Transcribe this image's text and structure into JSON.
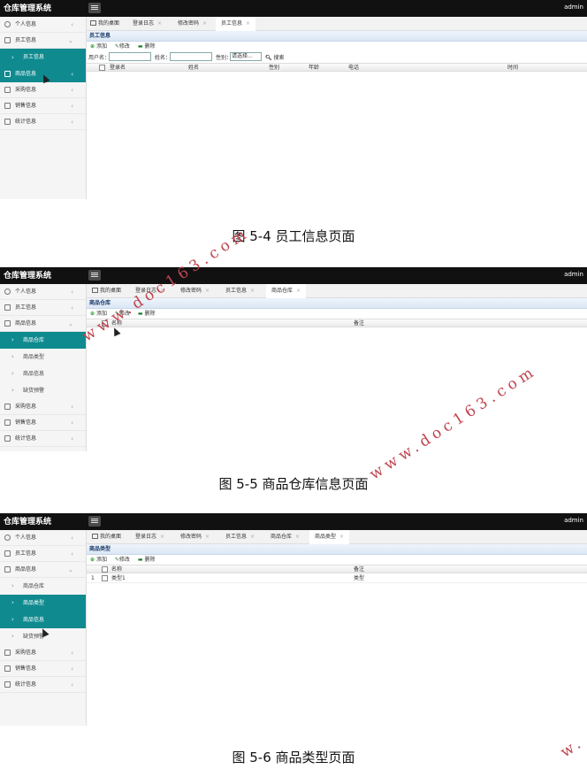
{
  "app_title": "仓库管理系统",
  "user": "admin",
  "tab_close": "×",
  "sidebar": {
    "personal": "个人信息",
    "employee": "员工信息",
    "employee_info": "员工信息",
    "goods": "商品信息",
    "purchase": "采购信息",
    "sales": "销售信息",
    "stats": "统计信息",
    "goods_warehouse": "商品仓库",
    "goods_type": "商品类型",
    "goods_info": "商品信息",
    "stock_alert": "缺货预警"
  },
  "tabs": {
    "desk": "我的桌面",
    "login_log": "登录日志",
    "change_pwd": "修改密码",
    "employee": "员工信息",
    "goods_warehouse": "商品仓库",
    "goods_type": "商品类型"
  },
  "toolbar": {
    "add": "添加",
    "edit": "修改",
    "delete": "删除"
  },
  "shot1": {
    "panel_title": "员工信息",
    "search": {
      "username": "用户名：",
      "name": "姓名：",
      "gender": "性别：",
      "select": "请选择...",
      "search_btn": "搜索"
    },
    "columns": [
      "登录名",
      "姓名",
      "性别",
      "年龄",
      "电话",
      "时间"
    ]
  },
  "shot2": {
    "panel_title": "商品仓库",
    "columns": [
      "名称",
      "备注"
    ]
  },
  "shot3": {
    "panel_title": "商品类型",
    "columns": [
      "名称",
      "备注"
    ],
    "rows": [
      {
        "num": "1",
        "name": "类型1",
        "note": "类型"
      }
    ]
  },
  "captions": {
    "fig1": "图 5-4 员工信息页面",
    "fig2": "图 5-5 商品仓库信息页面",
    "fig3": "图 5-6 商品类型页面"
  },
  "watermark": "www.doc163.com",
  "watermark_short": "w."
}
